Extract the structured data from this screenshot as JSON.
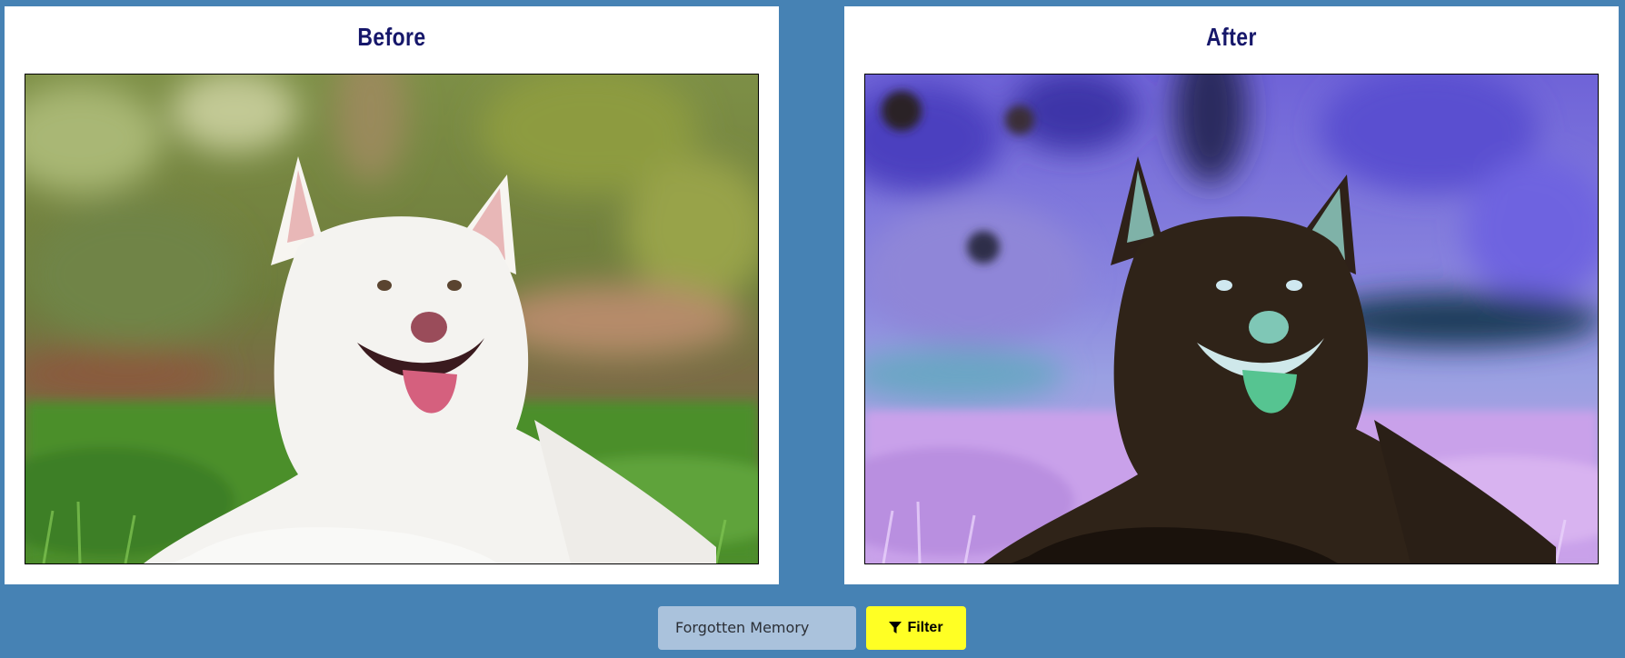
{
  "before": {
    "title": "Before",
    "image": "white-dog-photo"
  },
  "after": {
    "title": "After",
    "image": "inverted-dog-photo"
  },
  "controls": {
    "filter_value": "Forgotten Memory",
    "filter_button_label": "Filter",
    "filter_button_icon": "funnel-icon"
  },
  "colors": {
    "background": "#4682b4",
    "title": "#16176a",
    "select_bg": "#aac2dc",
    "button_bg": "#ffff24"
  }
}
